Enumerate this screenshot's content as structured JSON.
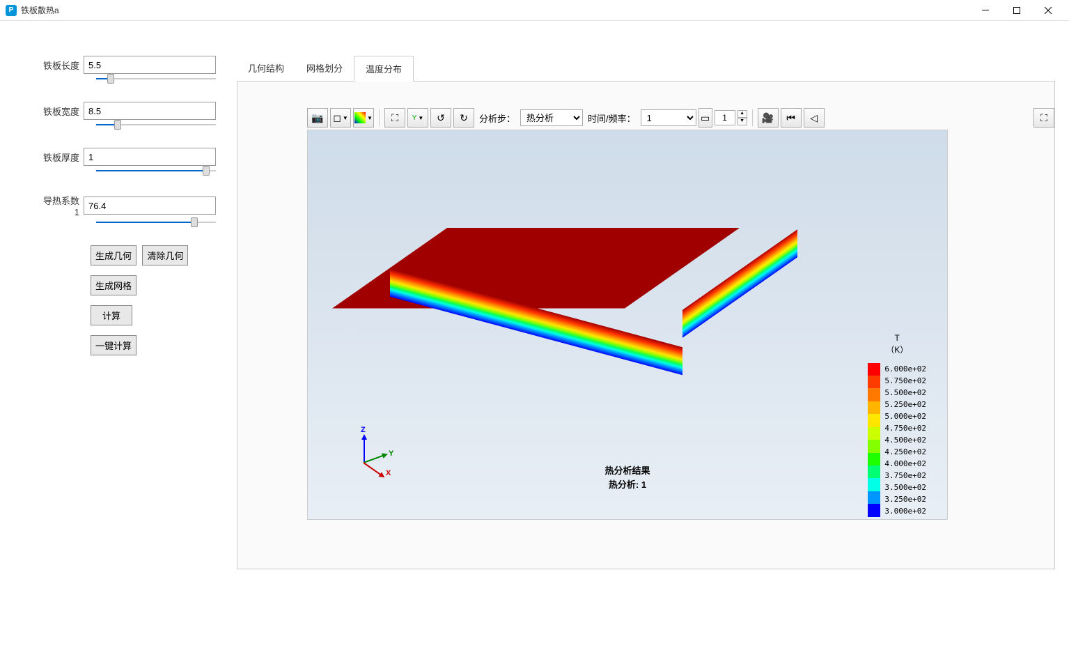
{
  "window": {
    "title": "铁板散热a",
    "app_icon_letter": "P"
  },
  "params": {
    "length": {
      "label": "铁板长度",
      "value": "5.5",
      "slider_pct": 12
    },
    "width": {
      "label": "铁板宽度",
      "value": "8.5",
      "slider_pct": 18
    },
    "thick": {
      "label": "铁板厚度",
      "value": "1",
      "slider_pct": 92
    },
    "cond": {
      "label": "导热系数1",
      "value": "76.4",
      "slider_pct": 82
    }
  },
  "buttons": {
    "gen_geom": "生成几何",
    "clear_geom": "清除几何",
    "gen_mesh": "生成网格",
    "compute": "计算",
    "one_click": "一键计算"
  },
  "tabs": {
    "geom": "几何结构",
    "mesh": "网格划分",
    "temp": "温度分布"
  },
  "toolbar": {
    "step_label": "分析步：",
    "step_selected": "热分析",
    "time_label": "时间/频率：",
    "time_selected": "1",
    "spin_value": "1"
  },
  "result": {
    "title": "热分析结果",
    "subtitle": "热分析: 1"
  },
  "axes": {
    "x": "X",
    "y": "Y",
    "z": "Z"
  },
  "legend": {
    "title1": "T",
    "title2": "（K）",
    "values": [
      "6.000e+02",
      "5.750e+02",
      "5.500e+02",
      "5.250e+02",
      "5.000e+02",
      "4.750e+02",
      "4.500e+02",
      "4.250e+02",
      "4.000e+02",
      "3.750e+02",
      "3.500e+02",
      "3.250e+02",
      "3.000e+02"
    ],
    "colors": [
      "#ff0000",
      "#ff3c00",
      "#ff7800",
      "#ffb400",
      "#ffe600",
      "#ccff00",
      "#84ff00",
      "#1eff00",
      "#00ff72",
      "#00ffe6",
      "#0096ff",
      "#0000ff"
    ]
  }
}
